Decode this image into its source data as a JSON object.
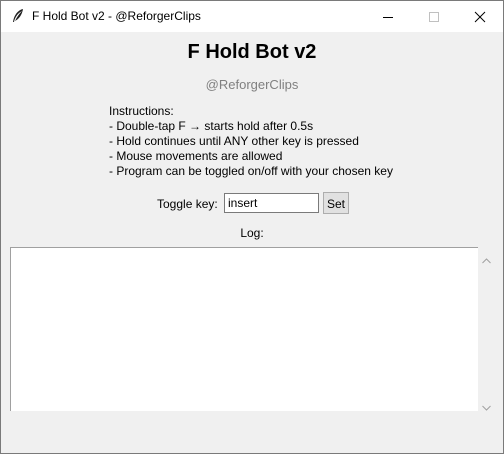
{
  "window": {
    "title": "F Hold Bot v2 - @ReforgerClips",
    "app_icon": "feather-icon",
    "controls": [
      "minimize-icon",
      "maximize-icon",
      "close-icon"
    ]
  },
  "header": {
    "title": "F Hold Bot v2",
    "subtitle": "@ReforgerClips",
    "subtitle_color": "#808080"
  },
  "instructions": {
    "heading": "Instructions:",
    "lines": [
      "- Double-tap F → starts hold after 0.5s",
      "- Hold continues until ANY other key is pressed",
      "- Mouse movements are allowed",
      "- Program can be toggled on/off with your chosen key"
    ]
  },
  "toggle": {
    "label": "Toggle key:",
    "value": "insert",
    "set_label": "Set"
  },
  "log": {
    "label": "Log:",
    "content": ""
  }
}
